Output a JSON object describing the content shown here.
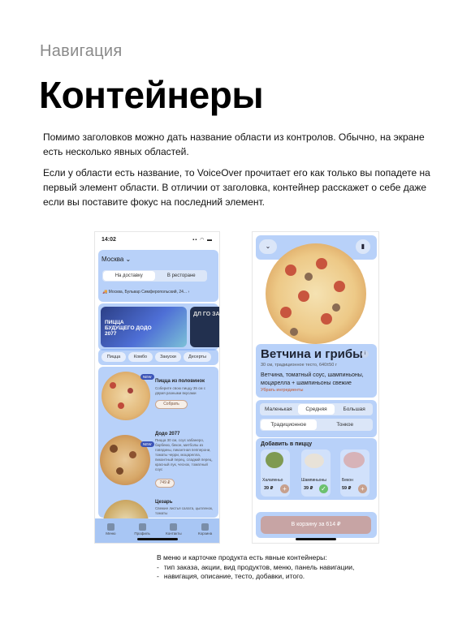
{
  "header": {
    "kicker": "Навигация",
    "title": "Контейнеры"
  },
  "paragraphs": [
    "Помимо заголовков можно дать название области из контролов. Обычно, на экране есть несколько явных областей.",
    "Если у области есть название, то VoiceOver прочитает его как только вы попадете на первый элемент области. В отличии от заголовка, контейнер расскажет о себе даже если вы поставите фокус на последний элемент."
  ],
  "phone_menu": {
    "status_time": "14:02",
    "status_icons": "▪▪ ◠ ▬",
    "city": "Москва",
    "order_types": [
      "На доставку",
      "В ресторане"
    ],
    "address": "Москва, Бульвар Симферопольский, 24...",
    "banner_text": "ПИЦЦА БУДУЩЕГО ДОДО 2077",
    "banner2_text": "ДЛ ГО ЗА",
    "categories": [
      "Пицца",
      "Комбо",
      "Закуски",
      "Десерты"
    ],
    "items": [
      {
        "title": "Пицца из половинок",
        "desc": "Соберите свою пиццу 35 см с двумя разными вкусами",
        "button": "Собрать",
        "badge": "NEW"
      },
      {
        "title": "Додо 2077",
        "desc": "Пицца 30 см, соус хабанеро, барбекю, бекон, митболы из говядины, пикантная пепперони, томаты черри, моцарелла, пикантный перец, сладкий перец, красный лук, чеснок, томатный соус",
        "button": "749 ₽",
        "badge": "NEW"
      },
      {
        "title": "Цезарь",
        "desc": "Свежие листья салата, цыпленок, томаты",
        "button": "",
        "badge": ""
      }
    ],
    "tabs": [
      "Меню",
      "Профиль",
      "Контакты",
      "Корзина"
    ]
  },
  "phone_product": {
    "name": "Ветчина и грибы",
    "sub": "30 см, традиционное тесто, 640±50 г",
    "desc": "Ветчина, томатный соус, шампиньоны, моцарелла + шампиньоны свежие",
    "remove_link": "Убрать ингредиенты",
    "sizes": [
      "Маленькая",
      "Средняя",
      "Большая"
    ],
    "dough": [
      "Традиционное",
      "Тонкое"
    ],
    "add_title": "Добавить в пиццу",
    "addons": [
      {
        "name": "Халапеньо",
        "price": "39 ₽"
      },
      {
        "name": "Шампиньоны",
        "price": "39 ₽"
      },
      {
        "name": "Бекон",
        "price": "59 ₽"
      }
    ],
    "cart_button": "В корзину за 614 ₽"
  },
  "caption": {
    "intro": "В меню и карточке продукта есть явные контейнеры:",
    "items": [
      "тип заказа, акции, вид продуктов, меню, панель навигации,",
      "навигация, описание, тесто, добавки, итого."
    ]
  }
}
